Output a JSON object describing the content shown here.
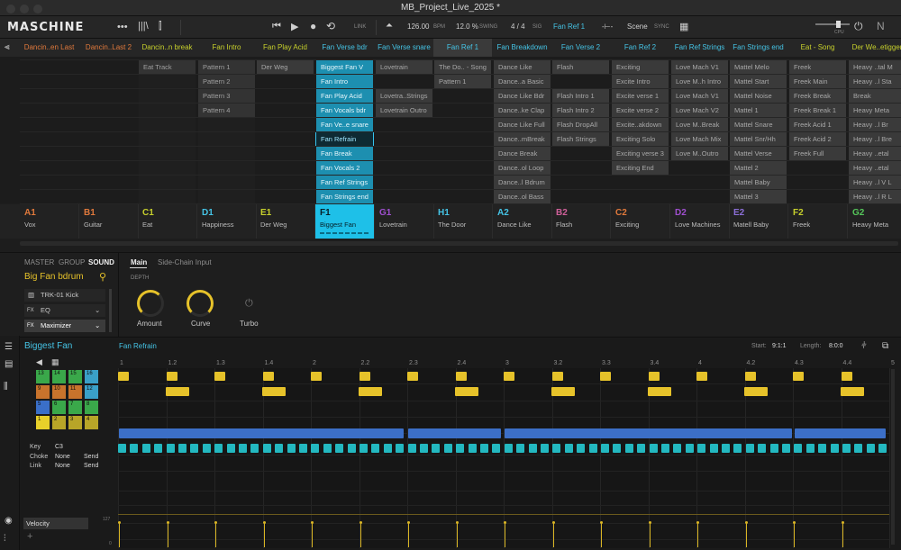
{
  "window": {
    "title": "MB_Project_Live_2025 *"
  },
  "header": {
    "logo": "MASCHINE",
    "tempo": "126.00",
    "tempo_unit": "BPM",
    "swing": "12.0 %",
    "swing_unit": "SWING",
    "sig": "4 / 4",
    "sig_unit": "SIG",
    "scene": "Fan Ref 1",
    "link": "LINK",
    "scene_label": "Scene",
    "sync": "SYNC",
    "cpu": "CPU"
  },
  "scenes": [
    "Dancin..en Last",
    "Dancin..Last 2",
    "Dancin..n break",
    "Fan Intro",
    "Fan Play Acid",
    "Fan Verse bdr",
    "Fan Verse snare",
    "Fan Ref 1",
    "Fan Breakdown",
    "Fan Verse 2",
    "Fan Ref 2",
    "Fan Ref Strings",
    "Fan Strings end",
    "Eat - Song",
    "Der We..etigger"
  ],
  "scene_colors": [
    "#e0793c",
    "#e0793c",
    "#c7d02c",
    "#c7d02c",
    "#c7d02c",
    "#45c4e6",
    "#45c4e6",
    "#45c4e6",
    "#45c4e6",
    "#45c4e6",
    "#45c4e6",
    "#45c4e6",
    "#45c4e6",
    "#c7d02c",
    "#c7d02c"
  ],
  "clips": [
    [
      "",
      "",
      "Eat Track",
      "Pattern 1",
      "Der Weg",
      "Biggest Fan V",
      "Lovetrain",
      "The Do.. - Song",
      "Dance Like",
      "Flash",
      "Exciting",
      "Love Mach V1",
      "Mattel Melo",
      "Freek",
      "Heavy ..tal M"
    ],
    [
      "",
      "",
      "",
      "Pattern 2",
      "",
      "Fan Intro",
      "",
      "Pattern 1",
      "Dance..a Basic",
      "",
      "Excite Intro",
      "Love M..h Intro",
      "Mattel Start",
      "Freek Main",
      "Heavy ..l Sta"
    ],
    [
      "",
      "",
      "",
      "Pattern 3",
      "",
      "Fan Play Acid",
      "Lovetra..Strings",
      "",
      "Dance Like Bdr",
      "Flash Intro 1",
      "Excite verse 1",
      "Love Mach V1",
      "Mattel Noise",
      "Freek Break",
      "Break"
    ],
    [
      "",
      "",
      "",
      "Pattern 4",
      "",
      "Fan Vocals bdr",
      "Lovetrain Outro",
      "",
      "Dance..ke Clap",
      "Flash Intro 2",
      "Excite verse 2",
      "Love Mach V2",
      "Mattel 1",
      "Freek Break 1",
      "Heavy Meta"
    ],
    [
      "",
      "",
      "",
      "",
      "",
      "Fan Ve..e snare",
      "",
      "",
      "Dance Like Full",
      "Flash DropAll",
      "Excite..akdown",
      "Love M..Break",
      "Mattel Snare",
      "Freek Acid 1",
      "Heavy ..l Br"
    ],
    [
      "",
      "",
      "",
      "",
      "",
      "Fan Refrain",
      "",
      "",
      "Dance..mBreak",
      "Flash Strings",
      "Exciting Solo",
      "Love Mach Mix",
      "Mattel Snr/Hh",
      "Freek Acid 2",
      "Heavy ..l Bre"
    ],
    [
      "",
      "",
      "",
      "",
      "",
      "Fan Break",
      "",
      "",
      "Dance Break",
      "",
      "Exciting verse 3",
      "Love M..Outro",
      "Mattel Verse",
      "Freek Full",
      "Heavy ..etal"
    ],
    [
      "",
      "",
      "",
      "",
      "",
      "Fan Vocals 2",
      "",
      "",
      "Dance..ol Loop",
      "",
      "Exciting End",
      "",
      "Mattel 2",
      "",
      "Heavy ..etal"
    ],
    [
      "",
      "",
      "",
      "",
      "",
      "Fan Ref Strings",
      "",
      "",
      "Dance..l Bdrum",
      "",
      "",
      "",
      "Mattel Baby",
      "",
      "Heavy ..l V L"
    ],
    [
      "",
      "",
      "",
      "",
      "",
      "Fan Strings end",
      "",
      "",
      "Dance..ol Bass",
      "",
      "",
      "",
      "Mattel 3",
      "",
      "Heavy ..l R L"
    ]
  ],
  "groups": [
    {
      "letter": "A1",
      "name": "Vox",
      "color": "#e0793c"
    },
    {
      "letter": "B1",
      "name": "Guitar",
      "color": "#e0793c"
    },
    {
      "letter": "C1",
      "name": "Eat",
      "color": "#c7d02c"
    },
    {
      "letter": "D1",
      "name": "Happiness",
      "color": "#45c4e6"
    },
    {
      "letter": "E1",
      "name": "Der Weg",
      "color": "#c7d02c"
    },
    {
      "letter": "F1",
      "name": "Biggest Fan",
      "color": "#062029"
    },
    {
      "letter": "G1",
      "name": "Lovetrain",
      "color": "#a04fd0"
    },
    {
      "letter": "H1",
      "name": "The Door",
      "color": "#45c4e6"
    },
    {
      "letter": "A2",
      "name": "Dance Like",
      "color": "#45c4e6"
    },
    {
      "letter": "B2",
      "name": "Flash",
      "color": "#d0609a"
    },
    {
      "letter": "C2",
      "name": "Exciting",
      "color": "#e0793c"
    },
    {
      "letter": "D2",
      "name": "Love Machines",
      "color": "#a04fd0"
    },
    {
      "letter": "E2",
      "name": "Matell Baby",
      "color": "#8c6fd8"
    },
    {
      "letter": "F2",
      "name": "Freek",
      "color": "#c7d02c"
    },
    {
      "letter": "G2",
      "name": "Heavy Meta",
      "color": "#55c75a"
    }
  ],
  "sound": {
    "tabs": [
      "MASTER",
      "GROUP",
      "SOUND"
    ],
    "name": "Big Fan bdrum",
    "slots": [
      "TRK-01 Kick",
      "EQ",
      "Maximizer"
    ],
    "plugin_tabs": [
      "Main",
      "Side-Chain Input"
    ],
    "depth_label": "DEPTH",
    "knobs": [
      "Amount",
      "Curve",
      "Turbo"
    ]
  },
  "pattern": {
    "group_name": "Biggest Fan",
    "pattern_name": "Fan Refrain",
    "start_label": "Start:",
    "start_value": "9:1:1",
    "length_label": "Length:",
    "length_value": "8:0:0",
    "pads": [
      {
        "n": "13",
        "c": "#3aa84a"
      },
      {
        "n": "14",
        "c": "#3aa84a"
      },
      {
        "n": "15",
        "c": "#3aa84a"
      },
      {
        "n": "16",
        "c": "#3aa0c8"
      },
      {
        "n": "9",
        "c": "#c8732c"
      },
      {
        "n": "10",
        "c": "#c8732c"
      },
      {
        "n": "11",
        "c": "#c8732c"
      },
      {
        "n": "12",
        "c": "#3aa0c8"
      },
      {
        "n": "5",
        "c": "#3a6fc8"
      },
      {
        "n": "6",
        "c": "#3aa84a"
      },
      {
        "n": "7",
        "c": "#3aa84a"
      },
      {
        "n": "8",
        "c": "#3aa84a"
      },
      {
        "n": "1",
        "c": "#e8d02a"
      },
      {
        "n": "2",
        "c": "#b8a528"
      },
      {
        "n": "3",
        "c": "#b8a528"
      },
      {
        "n": "4",
        "c": "#b8a528"
      }
    ],
    "key_label": "Key",
    "key_value": "C3",
    "choke_label": "Choke",
    "choke_value": "None",
    "choke_send": "Send",
    "link_label": "Link",
    "link_value": "None",
    "link_send": "Send",
    "ruler": [
      "1",
      "1.2",
      "1.3",
      "1.4",
      "2",
      "2.2",
      "2.3",
      "2.4",
      "3",
      "3.2",
      "3.3",
      "3.4",
      "4",
      "4.2",
      "4.3",
      "4.4",
      "5"
    ],
    "velocity_label": "Velocity",
    "vel_max": "127",
    "vel_min": "0"
  }
}
